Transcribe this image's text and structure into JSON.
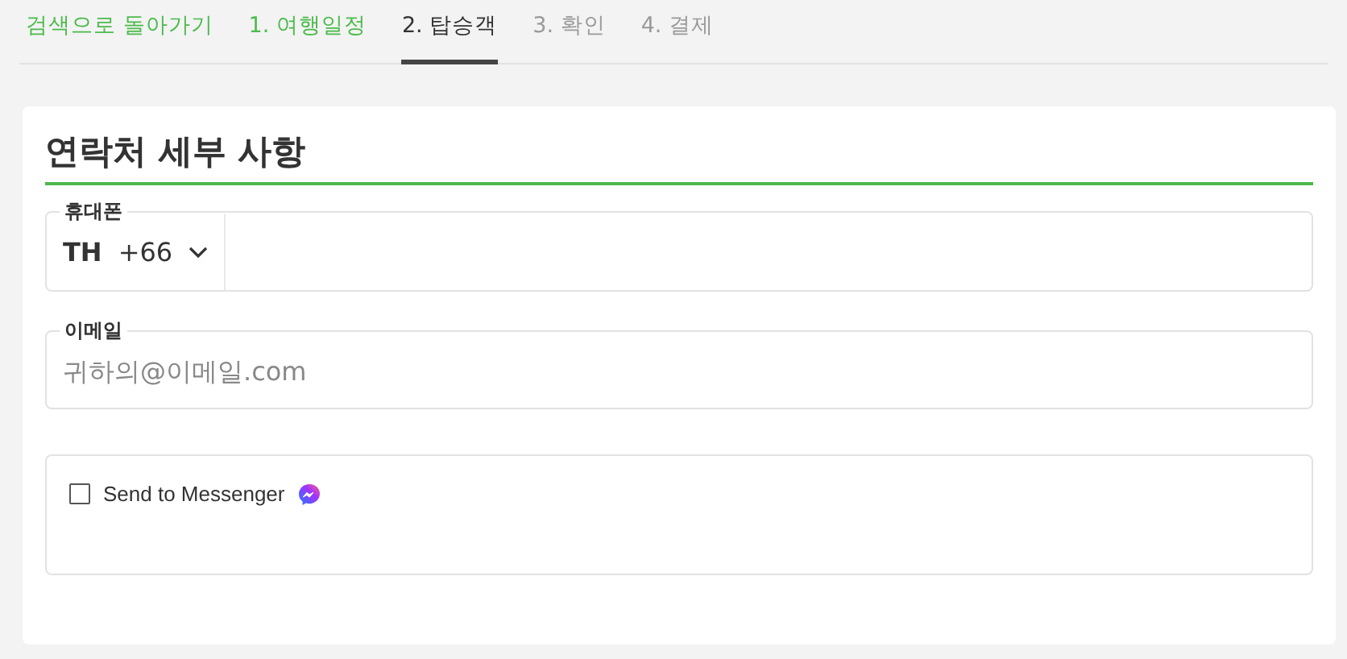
{
  "nav": [
    {
      "label": "검색으로 돌아가기",
      "kind": "back"
    },
    {
      "label": "1. 여행일정",
      "kind": "step",
      "selected": false,
      "completed": true
    },
    {
      "label": "2. 탑승객",
      "kind": "step",
      "selected": true,
      "completed": false
    },
    {
      "label": "3. 확인",
      "kind": "step",
      "selected": false,
      "completed": false
    },
    {
      "label": "4. 결제",
      "kind": "step",
      "selected": false,
      "completed": false
    }
  ],
  "section": {
    "title": "연락처 세부 사항",
    "phone": {
      "label": "휴대폰",
      "country": "TH",
      "code": "+66"
    },
    "email": {
      "label": "이메일",
      "placeholder": "귀하의@이메일.com"
    },
    "messenger": {
      "label": "Send to Messenger",
      "checked": false
    }
  }
}
